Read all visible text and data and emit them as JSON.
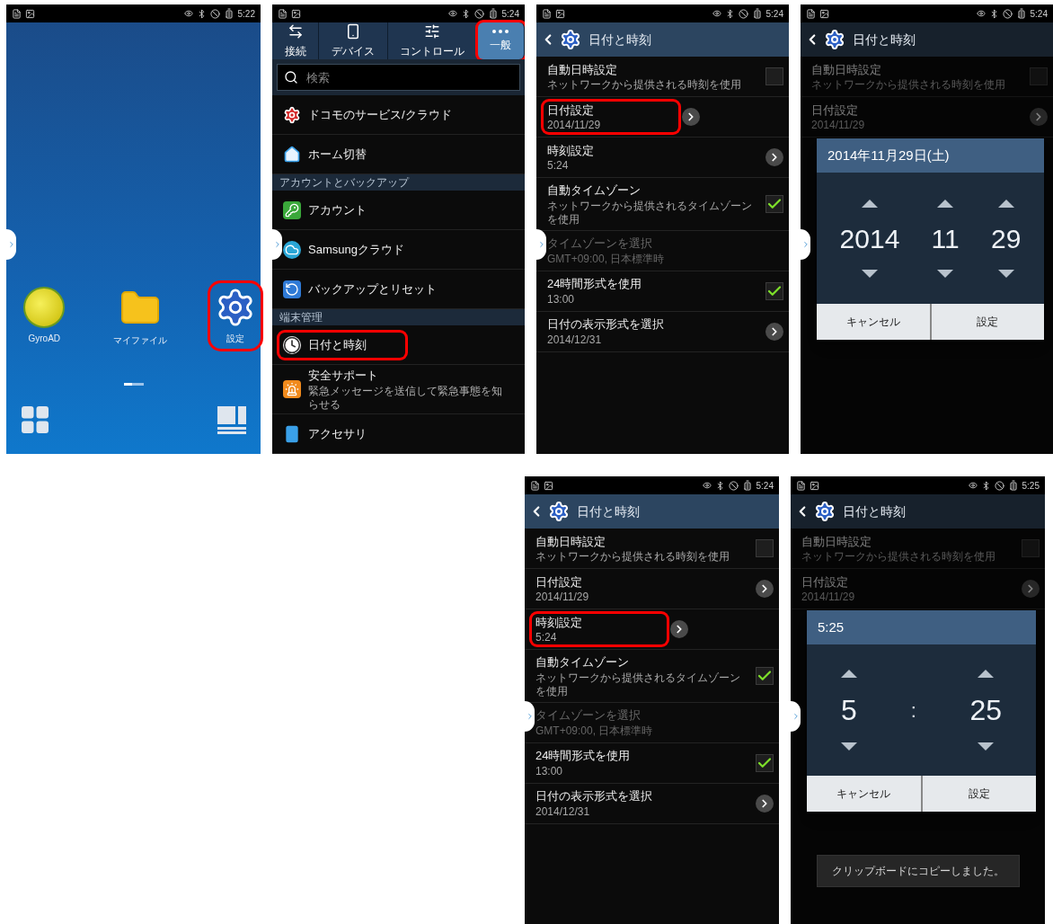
{
  "top_row": [
    {
      "kind": "home",
      "status_time": "5:22",
      "apps": [
        {
          "kind": "logo",
          "label": "GyroAD",
          "highlighted": false
        },
        {
          "kind": "folder",
          "label": "マイファイル",
          "highlighted": false
        },
        {
          "kind": "settings",
          "label": "設定",
          "highlighted": true
        }
      ]
    },
    {
      "kind": "menu",
      "status_time": "5:24",
      "tabs": [
        {
          "label": "接続",
          "selected": false,
          "highlighted": false
        },
        {
          "label": "デバイス",
          "selected": false,
          "highlighted": false
        },
        {
          "label": "コントロール",
          "selected": false,
          "highlighted": false
        },
        {
          "label": "一般",
          "selected": true,
          "highlighted": true
        }
      ],
      "search": {
        "placeholder": "検索"
      },
      "items": [
        {
          "kind": "item",
          "label": "ドコモのサービス/クラウド",
          "highlighted": false
        },
        {
          "kind": "item",
          "label": "ホーム切替",
          "highlighted": false
        },
        {
          "kind": "section",
          "label": "アカウントとバックアップ",
          "highlighted": false
        },
        {
          "kind": "item",
          "label": "アカウント",
          "highlighted": false
        },
        {
          "kind": "item",
          "label": "Samsungクラウド",
          "highlighted": false
        },
        {
          "kind": "item",
          "label": "バックアップとリセット",
          "highlighted": false
        },
        {
          "kind": "section",
          "label": "端末管理",
          "highlighted": false
        },
        {
          "kind": "item",
          "label": "日付と時刻",
          "highlighted": true
        },
        {
          "kind": "item",
          "label": "安全サポート",
          "subtitle": "緊急メッセージを送信して緊急事態を知らせる",
          "highlighted": false
        },
        {
          "kind": "item",
          "label": "アクセサリ",
          "highlighted": false
        }
      ]
    },
    {
      "kind": "datetime",
      "status_time": "5:24",
      "title": "日付と時刻",
      "rows": [
        {
          "kind": "checkbox",
          "label": "自動日時設定",
          "subtitle": "ネットワークから提供される時刻を使用",
          "checked": false,
          "disabled": false,
          "highlighted": false
        },
        {
          "kind": "link",
          "label": "日付設定",
          "subtitle": "2014/11/29",
          "disabled": false,
          "highlighted": true
        },
        {
          "kind": "link",
          "label": "時刻設定",
          "subtitle": "5:24",
          "disabled": false,
          "highlighted": false
        },
        {
          "kind": "checkbox",
          "label": "自動タイムゾーン",
          "subtitle": "ネットワークから提供されるタイムゾーンを使用",
          "checked": true,
          "disabled": false,
          "highlighted": false
        },
        {
          "kind": "plain",
          "label": "タイムゾーンを選択",
          "subtitle": "GMT+09:00, 日本標準時",
          "disabled": true,
          "highlighted": false
        },
        {
          "kind": "checkbox",
          "label": "24時間形式を使用",
          "subtitle": "13:00",
          "checked": true,
          "disabled": false,
          "highlighted": false
        },
        {
          "kind": "link",
          "label": "日付の表示形式を選択",
          "subtitle": "2014/12/31",
          "disabled": false,
          "highlighted": false
        }
      ]
    },
    {
      "kind": "dialog",
      "status_time": "5:24",
      "title": "日付と時刻",
      "rows": [
        {
          "kind": "checkbox",
          "label": "自動日時設定",
          "subtitle": "ネットワークから提供される時刻を使用",
          "checked": false,
          "disabled": false,
          "highlighted": false
        },
        {
          "kind": "link",
          "label": "日付設定",
          "subtitle": "2014/11/29",
          "disabled": false,
          "highlighted": false
        }
      ],
      "dialog": {
        "title": "2014年11月29日(土)",
        "fields": [
          "2014",
          "11",
          "29"
        ],
        "buttons": [
          "キャンセル",
          "設定"
        ]
      }
    }
  ],
  "bottom_row": [
    {
      "kind": "datetime",
      "status_time": "5:24",
      "title": "日付と時刻",
      "rows": [
        {
          "kind": "checkbox",
          "label": "自動日時設定",
          "subtitle": "ネットワークから提供される時刻を使用",
          "checked": false,
          "disabled": false,
          "highlighted": false
        },
        {
          "kind": "link",
          "label": "日付設定",
          "subtitle": "2014/11/29",
          "disabled": false,
          "highlighted": false
        },
        {
          "kind": "link",
          "label": "時刻設定",
          "subtitle": "5:24",
          "disabled": false,
          "highlighted": true
        },
        {
          "kind": "checkbox",
          "label": "自動タイムゾーン",
          "subtitle": "ネットワークから提供されるタイムゾーンを使用",
          "checked": true,
          "disabled": false,
          "highlighted": false
        },
        {
          "kind": "plain",
          "label": "タイムゾーンを選択",
          "subtitle": "GMT+09:00, 日本標準時",
          "disabled": true,
          "highlighted": false
        },
        {
          "kind": "checkbox",
          "label": "24時間形式を使用",
          "subtitle": "13:00",
          "checked": true,
          "disabled": false,
          "highlighted": false
        },
        {
          "kind": "link",
          "label": "日付の表示形式を選択",
          "subtitle": "2014/12/31",
          "disabled": false,
          "highlighted": false
        }
      ]
    },
    {
      "kind": "dialog",
      "status_time": "5:25",
      "title": "日付と時刻",
      "rows": [
        {
          "kind": "checkbox",
          "label": "自動日時設定",
          "subtitle": "ネットワークから提供される時刻を使用",
          "checked": false,
          "disabled": false,
          "highlighted": false
        },
        {
          "kind": "link",
          "label": "日付設定",
          "subtitle": "2014/11/29",
          "disabled": false,
          "highlighted": false
        }
      ],
      "dialog": {
        "title": "5:25",
        "fields": [
          "5",
          "25"
        ],
        "separator": ":",
        "buttons": [
          "キャンセル",
          "設定"
        ]
      },
      "toast": "クリップボードにコピーしました。"
    }
  ]
}
